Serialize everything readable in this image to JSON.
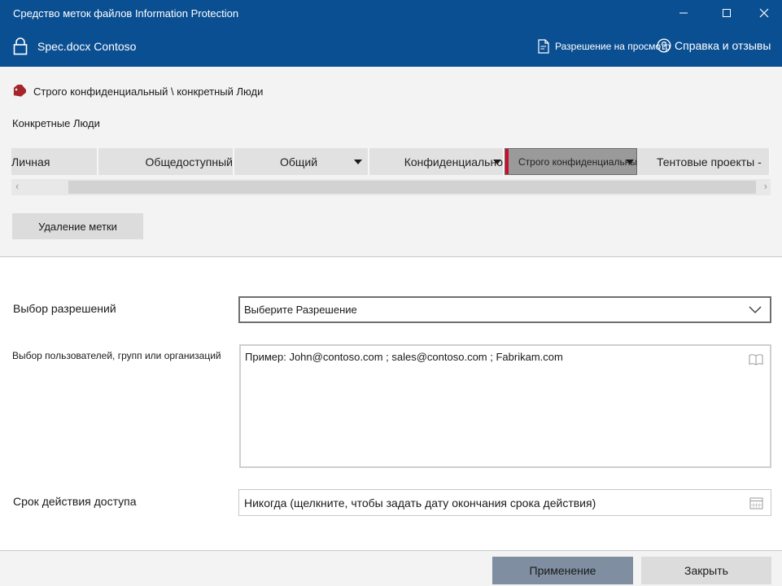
{
  "window": {
    "title": "Средство меток файлов Information Protection",
    "file_name": "Spec.docx Contoso",
    "view_permission": "Разрешение на просмотр",
    "help": "Справка и отзывы",
    "accent_color": "#0b4f93"
  },
  "current_label": {
    "text": "Строго конфиденциальный \\ конкретный Люди",
    "description": "Конкретные Люди",
    "tag_color": "#a4262c"
  },
  "labels": [
    {
      "label": "Личная",
      "has_dropdown": false,
      "selected": false
    },
    {
      "label": "Общедоступный",
      "has_dropdown": false,
      "selected": false
    },
    {
      "label": "Общий",
      "has_dropdown": true,
      "selected": false
    },
    {
      "label": "Конфиденциально",
      "has_dropdown": true,
      "selected": false
    },
    {
      "label": "Строго конфиденциальный",
      "has_dropdown": true,
      "selected": true
    },
    {
      "label": "Тентовые проекты -",
      "has_dropdown": false,
      "selected": false
    }
  ],
  "remove_label_button": "Удаление метки",
  "permissions": {
    "label": "Выбор разрешений",
    "value": "Выберите Разрешение"
  },
  "users": {
    "label": "Выбор пользователей, групп или организаций",
    "placeholder": "Пример: John@contoso.com ; sales@contoso.com ; Fabrikam.com"
  },
  "expiry": {
    "label": "Срок действия доступа",
    "value": "Никогда (щелкните, чтобы задать дату окончания срока действия)"
  },
  "footer": {
    "apply": "Применение",
    "close": "Закрыть"
  },
  "icons": [
    "minimize-icon",
    "maximize-icon",
    "close-icon",
    "lock-icon",
    "document-icon",
    "help-icon",
    "tag-icon",
    "chevron-down-icon",
    "address-book-icon",
    "calendar-icon"
  ]
}
